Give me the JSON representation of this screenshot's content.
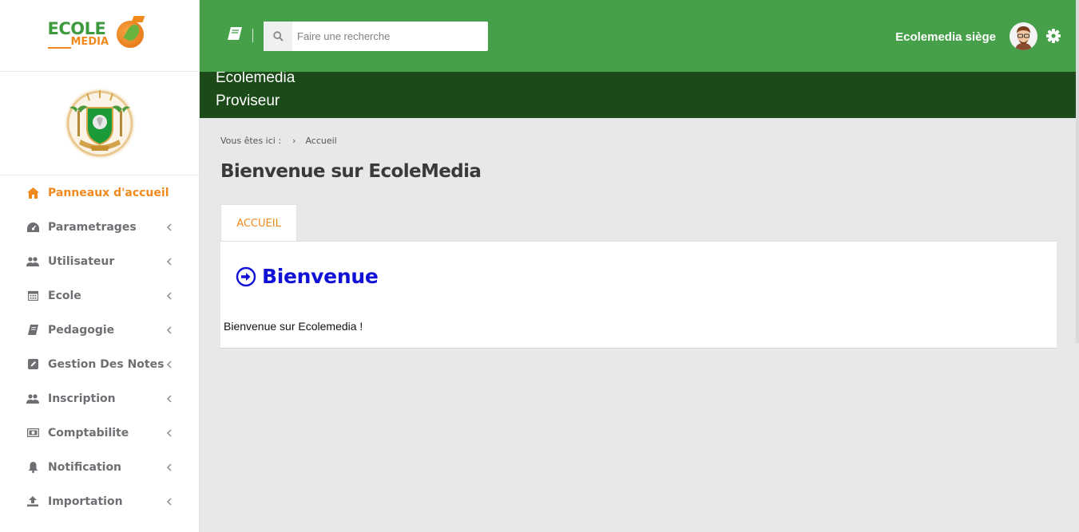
{
  "brand": {
    "logo_top": "ECOLE",
    "logo_bottom": "MEDIA"
  },
  "colors": {
    "topbar": "#46a049",
    "header_band": "#1d4a19",
    "accent": "#f08a1c",
    "welcome_heading": "#1010d6",
    "background": "#e6e8ea"
  },
  "sidebar": {
    "items": [
      {
        "label": "Panneaux d'accueil",
        "icon": "home-icon",
        "active": true
      },
      {
        "label": "Parametrages",
        "icon": "dashboard-icon"
      },
      {
        "label": "Utilisateur",
        "icon": "users-icon"
      },
      {
        "label": "Ecole",
        "icon": "calendar-icon"
      },
      {
        "label": "Pedagogie",
        "icon": "book-icon"
      },
      {
        "label": "Gestion Des Notes",
        "icon": "edit-icon"
      },
      {
        "label": "Inscription",
        "icon": "users-icon"
      },
      {
        "label": "Comptabilite",
        "icon": "money-icon"
      },
      {
        "label": "Notification",
        "icon": "bell-icon"
      },
      {
        "label": "Importation",
        "icon": "upload-icon"
      }
    ]
  },
  "topbar": {
    "search_placeholder": "Faire une recherche",
    "user_name": "Ecolemedia siège"
  },
  "header": {
    "title": "Ecolemedia",
    "subtitle": "Proviseur"
  },
  "breadcrumb": {
    "prefix": "Vous êtes ici :",
    "current": "Accueil"
  },
  "page": {
    "title": "Bienvenue sur EcoleMedia",
    "tab_label": "ACCUEIL",
    "welcome_heading": "Bienvenue",
    "welcome_text": "Bienvenue sur Ecolemedia !"
  }
}
